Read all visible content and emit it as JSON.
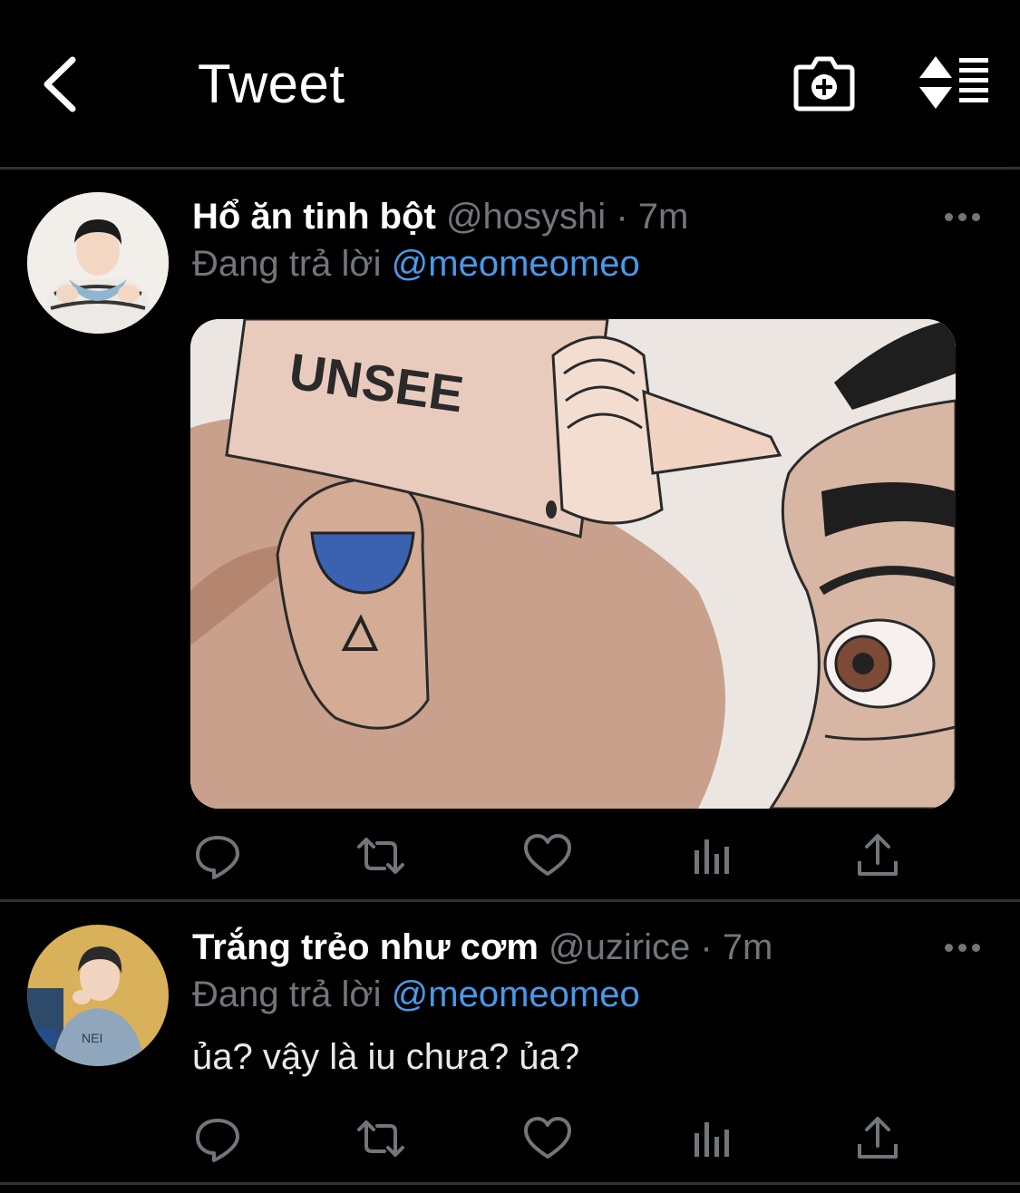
{
  "header": {
    "title": "Tweet",
    "back_icon": "chevron-left-icon",
    "camera_icon": "camera-add-icon",
    "sort_icon": "sort-timeline-icon"
  },
  "tweets": [
    {
      "display_name": "Hổ ăn tinh bột",
      "handle": "@hosyshi",
      "separator": "·",
      "time": "7m",
      "reply_prefix": "Đang trả lời",
      "reply_to": "@meomeomeo",
      "media_caption": "UNSEE",
      "text": ""
    },
    {
      "display_name": "Trắng trẻo như cơm",
      "handle": "@uzirice",
      "separator": "·",
      "time": "7m",
      "reply_prefix": "Đang trả lời",
      "reply_to": "@meomeomeo",
      "text": "ủa? vậy là iu chưa? ủa?"
    }
  ],
  "actions": [
    "reply-icon",
    "retweet-icon",
    "like-icon",
    "analytics-icon",
    "share-icon"
  ],
  "colors": {
    "background": "#000000",
    "divider": "#2f3336",
    "secondary_text": "#71767b",
    "mention": "#4a99e9"
  }
}
